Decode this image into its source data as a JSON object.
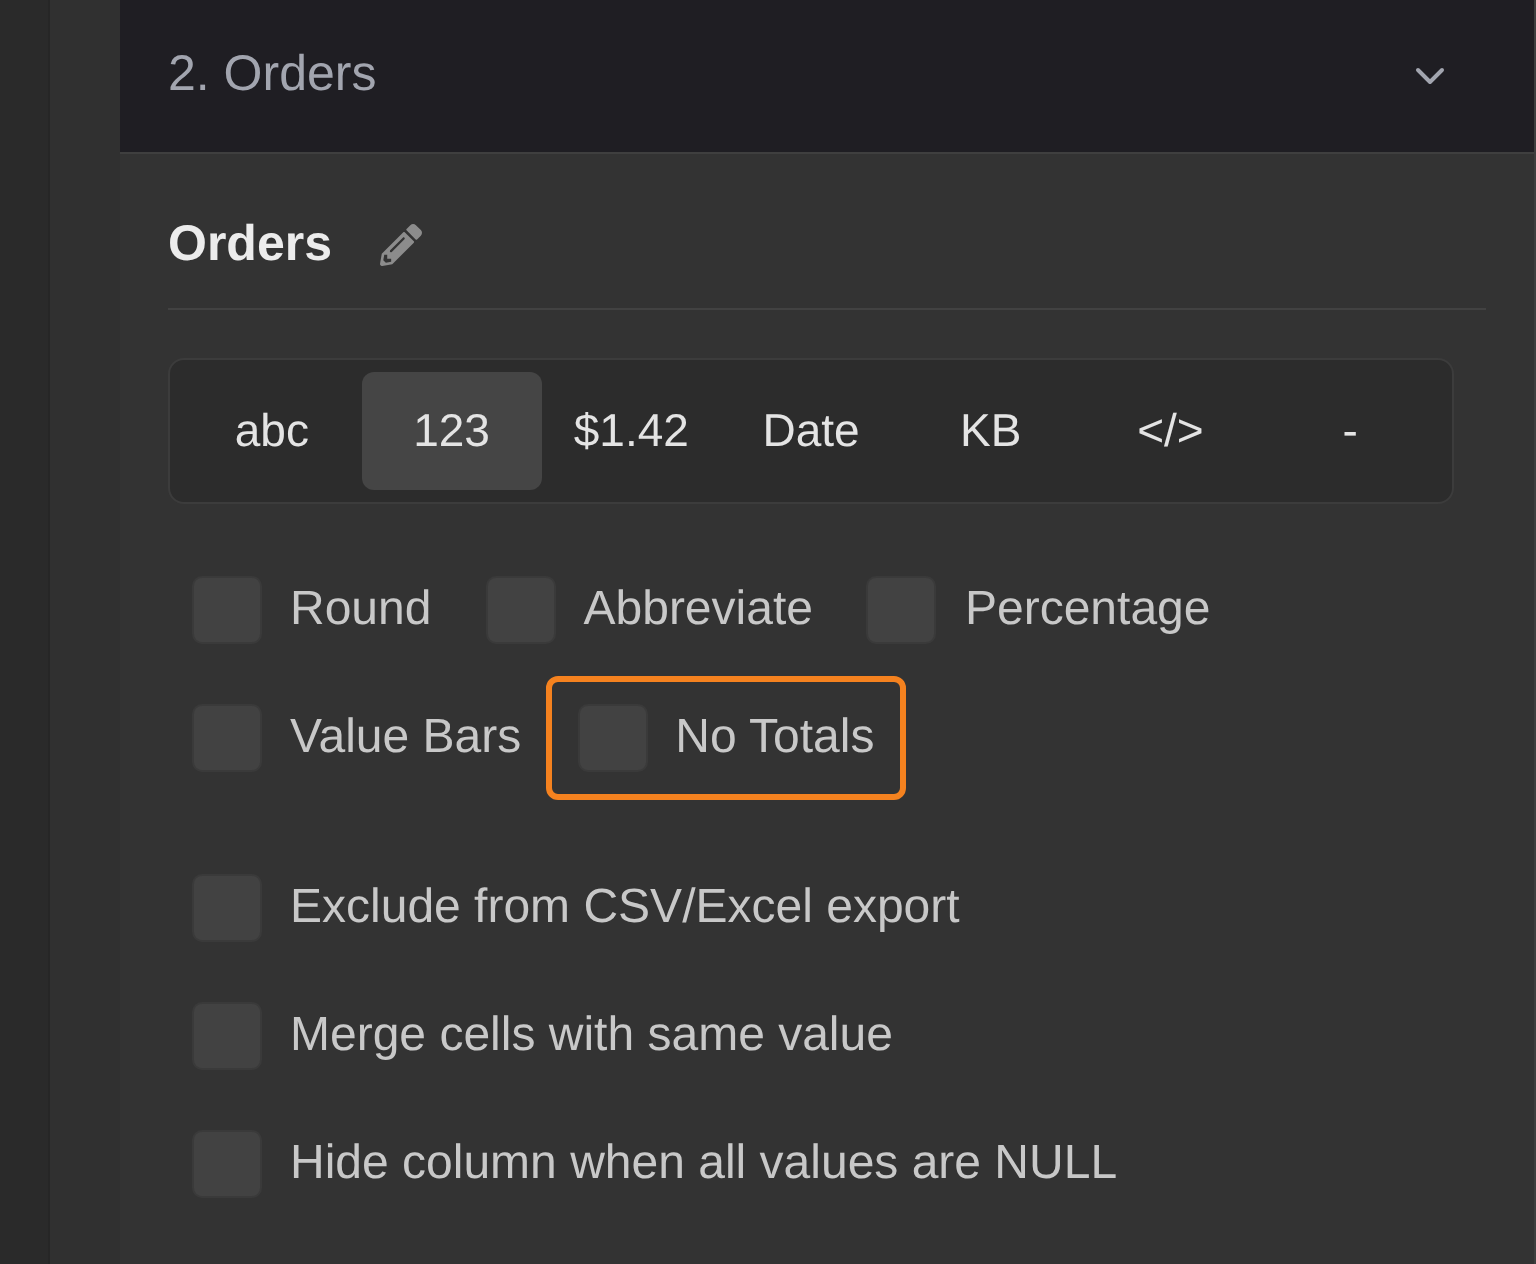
{
  "section": {
    "title": "2. Orders",
    "expanded": true
  },
  "column": {
    "name": "Orders"
  },
  "formats": [
    {
      "label": "abc",
      "selected": false
    },
    {
      "label": "123",
      "selected": true
    },
    {
      "label": "$1.42",
      "selected": false
    },
    {
      "label": "Date",
      "selected": false
    },
    {
      "label": "KB",
      "selected": false
    },
    {
      "label": "</>",
      "selected": false
    },
    {
      "label": "-",
      "selected": false
    }
  ],
  "options": [
    {
      "label": "Round",
      "checked": false,
      "highlighted": false
    },
    {
      "label": "Abbreviate",
      "checked": false,
      "highlighted": false
    },
    {
      "label": "Percentage",
      "checked": false,
      "highlighted": false
    },
    {
      "label": "Value Bars",
      "checked": false,
      "highlighted": false
    },
    {
      "label": "No Totals",
      "checked": false,
      "highlighted": true
    }
  ],
  "export_options": [
    {
      "label": "Exclude from CSV/Excel export",
      "checked": false
    },
    {
      "label": "Merge cells with same value",
      "checked": false
    },
    {
      "label": "Hide column when all values are NULL",
      "checked": false
    }
  ]
}
